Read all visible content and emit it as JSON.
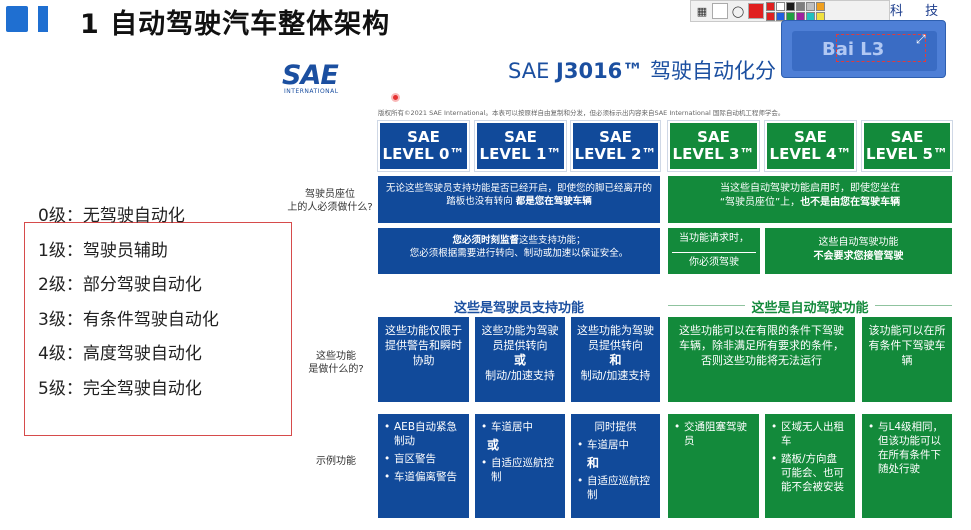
{
  "title": "1 自动驾驶汽车整体架构",
  "toolbar": {
    "tech_label": "科 技",
    "colors": [
      "#e02020",
      "#ffffff",
      "#1a1a1a",
      "#7f7f7f",
      "#c0c0c0",
      "#f0a020",
      "#e02020",
      "#2060e0",
      "#20a040",
      "#a020a0",
      "#20c0c0",
      "#f0e040"
    ]
  },
  "baidu": {
    "text": "Bai L3"
  },
  "sae": {
    "logo": "SAE",
    "logo_sub": "INTERNATIONAL",
    "title_prefix": "SAE ",
    "title_bold": "J3016™",
    "title_suffix": " 驾驶自动化分",
    "copyright_small": "版权所有©2021 SAE International。本表可以按原样自由复制和分发，但必须标示出内容来自SAE International 国际自动机工程师学会。",
    "watermark": "Copyright © 2021 SAE International."
  },
  "levels": [
    {
      "l1": "SAE",
      "l2": "LEVEL 0™"
    },
    {
      "l1": "SAE",
      "l2": "LEVEL 1™"
    },
    {
      "l1": "SAE",
      "l2": "LEVEL 2™"
    },
    {
      "l1": "SAE",
      "l2": "LEVEL 3™"
    },
    {
      "l1": "SAE",
      "l2": "LEVEL 4™"
    },
    {
      "l1": "SAE",
      "l2": "LEVEL 5™"
    }
  ],
  "row_labels": {
    "driver": "驾驶员座位\n上的人必须做什么?",
    "features": "这些功能\n是做什么的?",
    "examples": "示例功能"
  },
  "driver_row": {
    "blue_a": "无论这些驾驶员支持功能是否已经开启，即使您的脚已经离开的踏板也没有转向",
    "blue_a_bold": "都是您在驾驶车辆",
    "blue_b_bold": "您必须时刻监督",
    "blue_b": "这些支持功能；\n您必须根据需要进行转向、制动或加速以保证安全。",
    "green_a": "当这些自动驾驶功能启用时，即使您坐在\n“驾驶员座位”上，",
    "green_a_bold": "也不是由您在驾驶车辆",
    "green_b1": "当功能请求时，",
    "green_b2": "你必须驾驶",
    "green_c1": "这些自动驾驶功能",
    "green_c2": "不会要求您接管驾驶"
  },
  "sections": {
    "support": "这些是驾驶员支持功能",
    "automated": "这些是自动驾驶功能"
  },
  "features_row": {
    "l0": "这些功能仅限于提供警告和瞬时协助",
    "l1_a": "这些功能为驾驶员提供转向",
    "l1_b": "或",
    "l1_c": "制动/加速支持",
    "l2_a": "这些功能为驾驶员提供转向",
    "l2_b": "和",
    "l2_c": "制动/加速支持",
    "l34": "这些功能可以在有限的条件下驾驶车辆，除非满足所有要求的条件，否则这些功能将无法运行",
    "l5": "该功能可以在所有条件下驾驶车辆"
  },
  "examples_row": {
    "l0": [
      "AEB自动紧急制动",
      "盲区警告",
      "车道偏离警告"
    ],
    "l1_a": "车道居中",
    "l1_b": "或",
    "l1_c": "自适应巡航控制",
    "l2_head": "同时提供",
    "l2_a": "车道居中",
    "l2_b": "和",
    "l2_c": "自适应巡航控制",
    "l3": [
      "交通阻塞驾驶员"
    ],
    "l4": [
      "区域无人出租车",
      "踏板/方向盘 可能会、也可能不会被安装"
    ],
    "l5": [
      "与L4级相同，但该功能可以在所有条件下随处行驶"
    ]
  },
  "level_list": [
    "0级：无驾驶自动化",
    "1级：驾驶员辅助",
    "2级：部分驾驶自动化",
    "3级：有条件驾驶自动化",
    "4级：高度驾驶自动化",
    "5级：完全驾驶自动化"
  ]
}
